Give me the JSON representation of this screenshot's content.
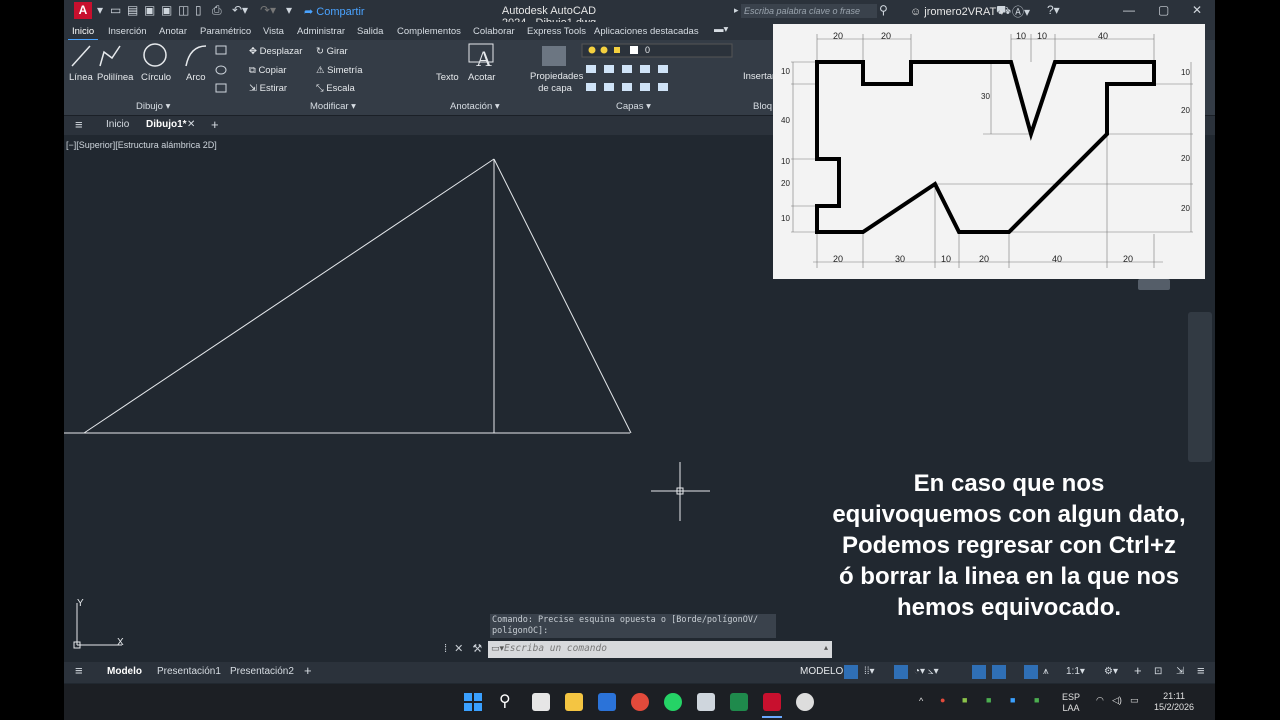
{
  "app": {
    "title": "Autodesk AutoCAD 2024",
    "file": "Dibujo1.dwg",
    "share": "Compartir",
    "search_placeholder": "Escriba palabra clave o frase",
    "user": "jromero2VRAT"
  },
  "menu_tabs": [
    "Inicio",
    "Inserción",
    "Anotar",
    "Paramétrico",
    "Vista",
    "Administrar",
    "Salida",
    "Complementos",
    "Colaborar",
    "Express Tools",
    "Aplicaciones destacadas"
  ],
  "ribbon": {
    "draw_tools": [
      "Línea",
      "Polilínea",
      "Círculo",
      "Arco"
    ],
    "modify_tools": [
      "Desplazar",
      "Girar",
      "Copiar",
      "Simetría",
      "Estirar",
      "Escala"
    ],
    "annotation_tools": [
      "Texto",
      "Acotar"
    ],
    "layer_props": "Propiedades de capa",
    "layer_value": "0",
    "insert": "Insertar",
    "panels": [
      "Dibujo",
      "Modificar",
      "Anotación",
      "Capas",
      "Bloq"
    ]
  },
  "file_tabs": {
    "home": "Inicio",
    "active": "Dibujo1*"
  },
  "viewport_label": "[−][Superior][Estructura alámbrica 2D]",
  "reference_dims": {
    "top": [
      "20",
      "20",
      "10",
      "10",
      "40"
    ],
    "bottom": [
      "20",
      "30",
      "10",
      "20",
      "40",
      "20"
    ],
    "left": [
      "10",
      "40",
      "10",
      "20",
      "10"
    ],
    "right": [
      "10",
      "20",
      "20",
      "20"
    ],
    "center": "30"
  },
  "overlay_lines": [
    "En caso que nos",
    "equivoquemos con algun dato,",
    "Podemos regresar con Ctrl+z",
    "ó borrar la linea en la que nos",
    "hemos equivocado."
  ],
  "command": {
    "history_1": "Comando: Precise esquina opuesta o [Borde/polígonOV/",
    "history_2": "polígonOC]:",
    "prompt": "Escriba un comando"
  },
  "layout_tabs": {
    "model": "Modelo",
    "layout1": "Presentación1",
    "layout2": "Presentación2"
  },
  "status": {
    "mode": "MODELO",
    "scale": "1:1"
  },
  "tray": {
    "lang_1": "ESP",
    "lang_2": "LAA",
    "time": "21:11",
    "date": "15/2/2026"
  }
}
